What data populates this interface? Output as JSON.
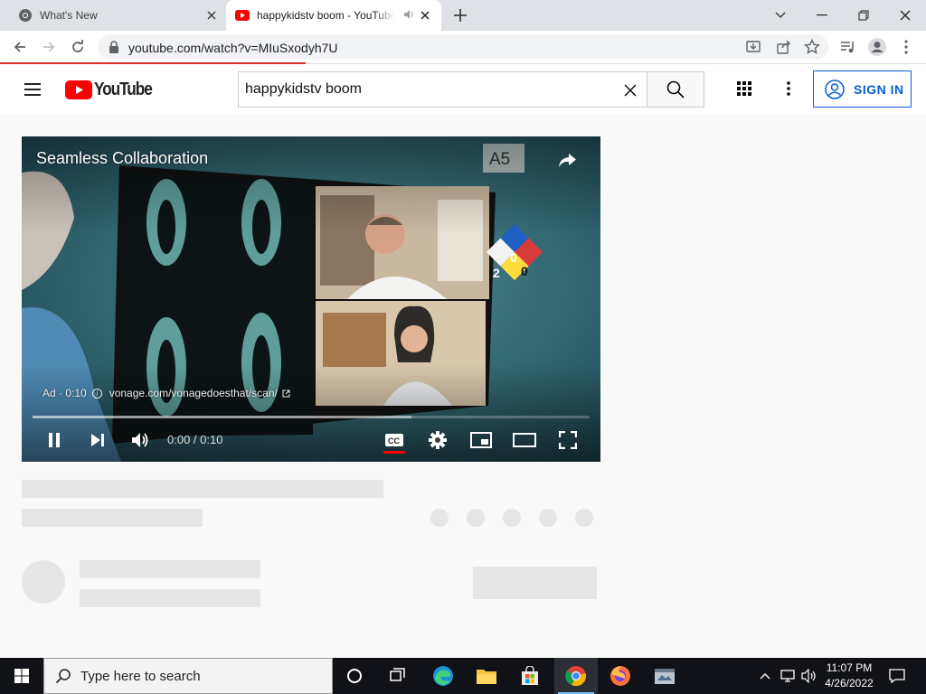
{
  "browser": {
    "tabs": [
      {
        "title": "What's New"
      },
      {
        "title": "happykidstv boom - YouTube"
      }
    ],
    "url": "youtube.com/watch?v=MIuSxodyh7U",
    "load_progress": 0.33
  },
  "youtube": {
    "logo_text": "YouTube",
    "search_query": "happykidstv boom",
    "sign_in_label": "SIGN IN"
  },
  "player": {
    "title": "Seamless Collaboration",
    "ad_label": "Ad · 0:10",
    "ad_url": "vonage.com/vonagedoesthat/scan/",
    "current_time": "0:00",
    "duration": "0:10",
    "time_separator": " / ",
    "buffered_fraction": 0.68,
    "scene_text": {
      "room_sign": "A5",
      "hazard_left": "2",
      "hazard_top": "0",
      "hazard_right": "0"
    }
  },
  "taskbar": {
    "search_placeholder": "Type here to search",
    "time": "11:07 PM",
    "date": "4/26/2022"
  },
  "colors": {
    "youtube_red": "#ff0000",
    "link_blue": "#065fd4",
    "taskbar": "#101218",
    "load_bar": "#d93025"
  }
}
